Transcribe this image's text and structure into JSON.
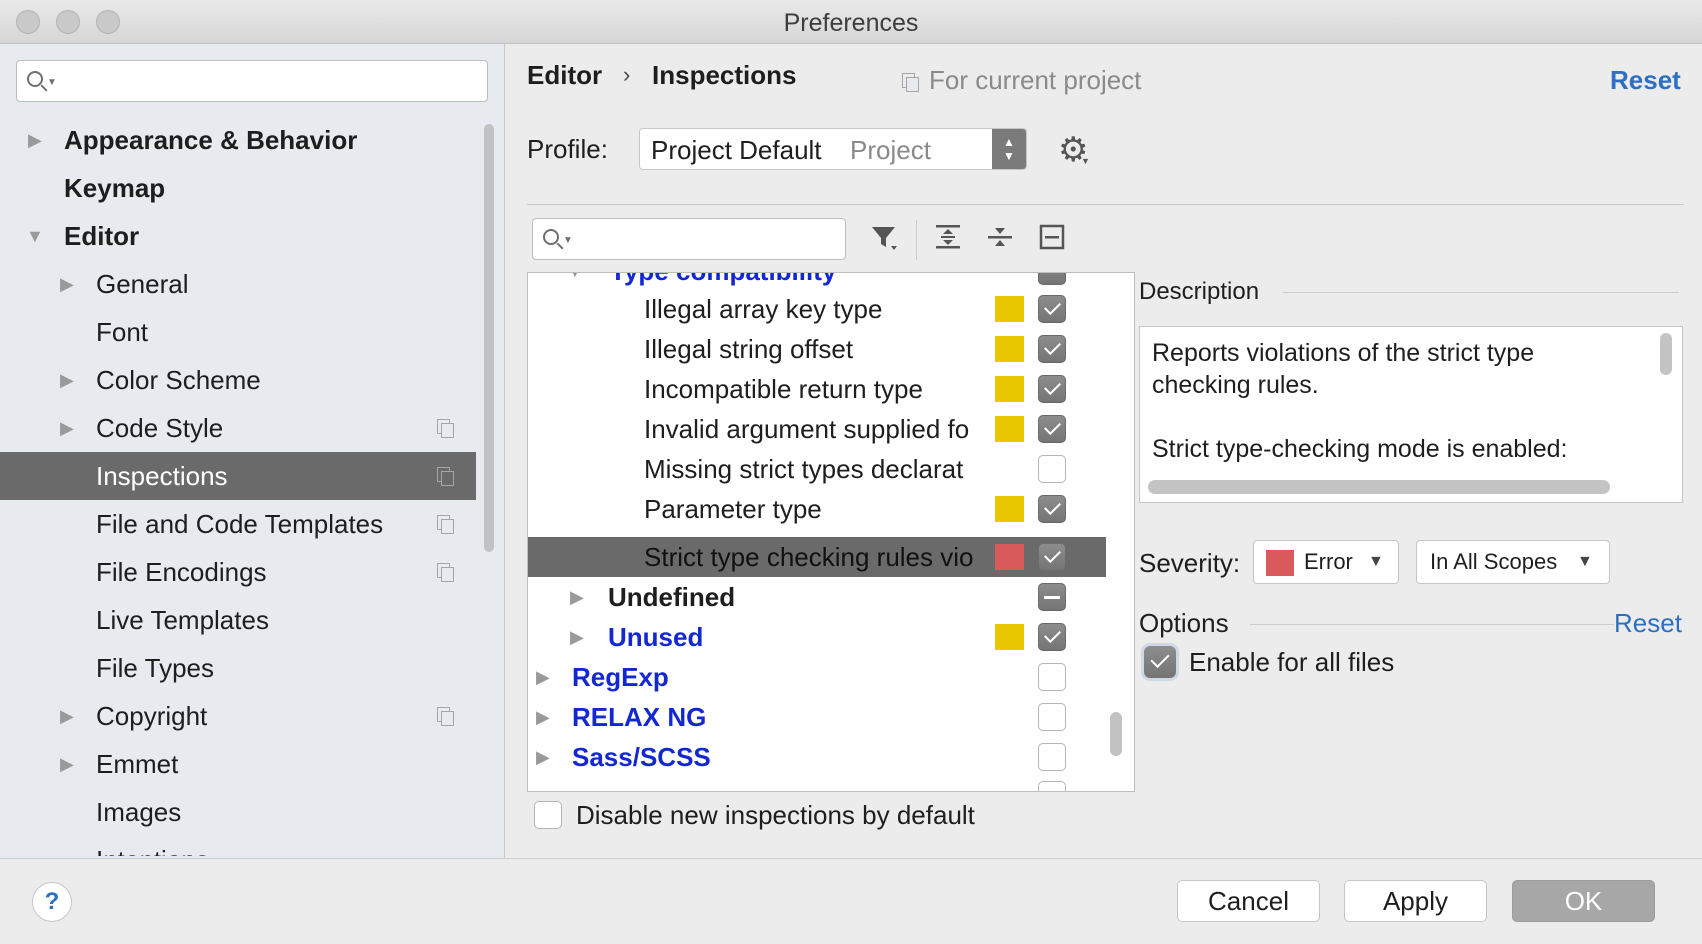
{
  "window": {
    "title": "Preferences"
  },
  "sidebar": {
    "search_placeholder": "",
    "items": [
      {
        "label": "Appearance & Behavior",
        "arrow": "▶"
      },
      {
        "label": "Keymap"
      },
      {
        "label": "Editor",
        "arrow": "▼"
      },
      {
        "label": "General",
        "arrow": "▶"
      },
      {
        "label": "Font"
      },
      {
        "label": "Color Scheme",
        "arrow": "▶"
      },
      {
        "label": "Code Style",
        "arrow": "▶"
      },
      {
        "label": "Inspections"
      },
      {
        "label": "File and Code Templates"
      },
      {
        "label": "File Encodings"
      },
      {
        "label": "Live Templates"
      },
      {
        "label": "File Types"
      },
      {
        "label": "Copyright",
        "arrow": "▶"
      },
      {
        "label": "Emmet",
        "arrow": "▶"
      },
      {
        "label": "Images"
      },
      {
        "label": "Intentions"
      }
    ]
  },
  "header": {
    "crumb_parent": "Editor",
    "crumb_separator": "›",
    "crumb_current": "Inspections",
    "scope_label": "For current project",
    "reset": "Reset"
  },
  "profile": {
    "label": "Profile:",
    "value": "Project Default",
    "sub": "Project"
  },
  "toolbar": {
    "filter_icon": "filter-icon",
    "expand_icon": "expand-all-icon",
    "collapse_icon": "collapse-all-icon",
    "reset_icon": "reset-to-empty-icon"
  },
  "inspections": {
    "partial_group": "Type compatibility",
    "rows": [
      {
        "label": "Illegal array key type",
        "severity_color": "#e8c600",
        "state": "on"
      },
      {
        "label": "Illegal string offset",
        "severity_color": "#e8c600",
        "state": "on"
      },
      {
        "label": "Incompatible return type",
        "severity_color": "#e8c600",
        "state": "on"
      },
      {
        "label": "Invalid argument supplied fo",
        "severity_color": "#e8c600",
        "state": "on"
      },
      {
        "label": "Missing strict types declarat",
        "severity_color": "",
        "state": "off"
      },
      {
        "label": "Parameter type",
        "severity_color": "#e8c600",
        "state": "on"
      },
      {
        "label": "Strict type checking rules vio",
        "severity_color": "#d85a5a",
        "state": "on",
        "selected": true
      },
      {
        "label": "Undefined",
        "group": "black",
        "severity_color": "",
        "state": "mixed"
      },
      {
        "label": "Unused",
        "group": "blue",
        "severity_color": "#e8c600",
        "state": "on"
      },
      {
        "label": "RegExp",
        "group": "blue",
        "severity_color": "",
        "state": "off"
      },
      {
        "label": "RELAX NG",
        "group": "blue",
        "severity_color": "",
        "state": "off"
      },
      {
        "label": "Sass/SCSS",
        "group": "blue",
        "severity_color": "",
        "state": "off"
      }
    ],
    "disable_new_label": "Disable new inspections by default"
  },
  "description": {
    "title": "Description",
    "lines": [
      "Reports violations of the strict type",
      "checking rules.",
      "",
      "Strict type-checking mode is enabled:"
    ]
  },
  "severity": {
    "label": "Severity:",
    "value": "Error",
    "value_color": "#d85a5a",
    "scope": "In All Scopes"
  },
  "options": {
    "title": "Options",
    "reset": "Reset",
    "enable_all_files": "Enable for all files"
  },
  "footer": {
    "help": "?",
    "cancel": "Cancel",
    "apply": "Apply",
    "ok": "OK"
  }
}
